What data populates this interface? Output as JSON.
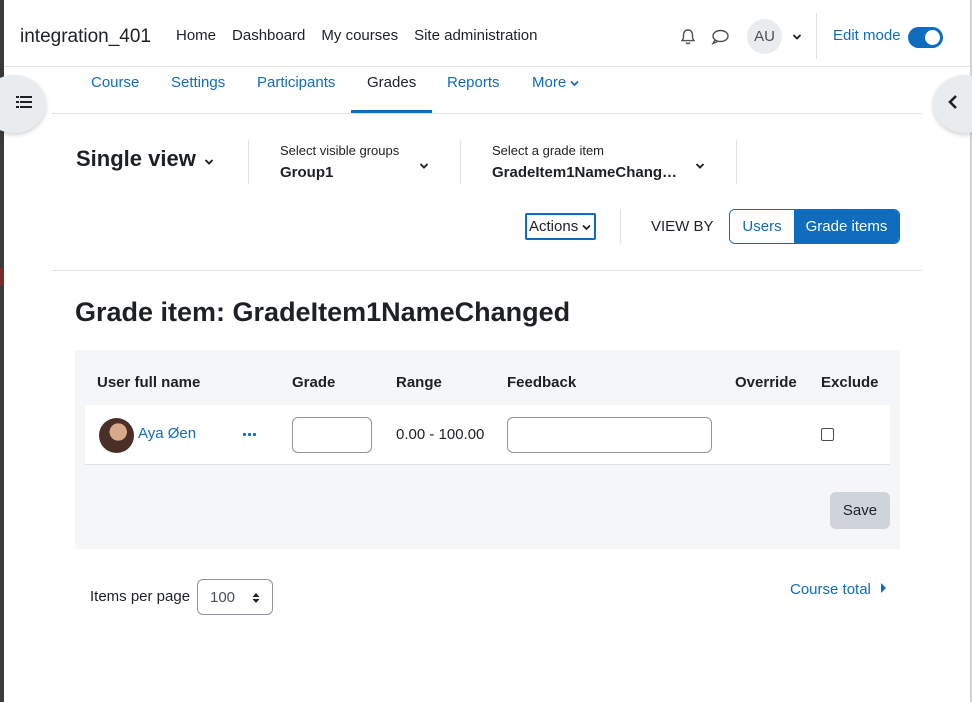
{
  "navbar": {
    "brand": "integration_401",
    "primary_nav": [
      "Home",
      "Dashboard",
      "My courses",
      "Site administration"
    ],
    "avatar_initials": "AU",
    "edit_mode_label": "Edit mode",
    "edit_mode_on": true
  },
  "secondary_nav": {
    "items": [
      "Course",
      "Settings",
      "Participants",
      "Grades",
      "Reports",
      "More"
    ],
    "active": "Grades"
  },
  "tertiary": {
    "report_selector": "Single view",
    "groups_label": "Select visible groups",
    "groups_value": "Group1",
    "grade_item_label": "Select a grade item",
    "grade_item_value": "GradeItem1NameChang…",
    "actions_label": "Actions",
    "view_by_label": "VIEW BY",
    "view_by_users": "Users",
    "view_by_grade_items": "Grade items",
    "view_by_selected": "Grade items"
  },
  "page_title": "Grade item: GradeItem1NameChanged",
  "table": {
    "headers": {
      "user": "User full name",
      "grade": "Grade",
      "range": "Range",
      "feedback": "Feedback",
      "override": "Override",
      "exclude": "Exclude"
    },
    "rows": [
      {
        "user": "Aya Øen",
        "grade": "",
        "range": "0.00 - 100.00",
        "feedback": "",
        "override": false,
        "exclude": false
      }
    ],
    "save_label": "Save"
  },
  "footer": {
    "items_per_page_label": "Items per page",
    "items_per_page_value": "100",
    "course_total_link": "Course total"
  },
  "colors": {
    "primary": "#0f6cbf",
    "text": "#1d2125",
    "panel_bg": "#f5f6f7",
    "save_bg": "#ced4da"
  }
}
